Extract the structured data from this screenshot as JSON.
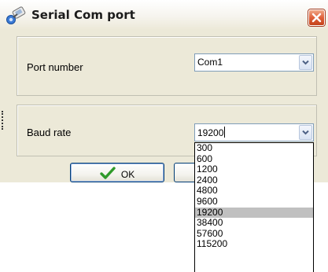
{
  "window": {
    "title": "Serial Com port"
  },
  "port": {
    "label": "Port number",
    "value": "Com1"
  },
  "baud": {
    "label": "Baud rate",
    "value": "19200",
    "options": [
      "300",
      "600",
      "1200",
      "2400",
      "4800",
      "9600",
      "19200",
      "38400",
      "57600",
      "115200"
    ],
    "selected_index": 6
  },
  "buttons": {
    "ok_label": "OK"
  },
  "icons": {
    "app": "serial-port-icon",
    "close": "close-icon",
    "dropdown": "chevron-down-icon",
    "ok": "checkmark-icon"
  },
  "colors": {
    "close_button": "#e0603a",
    "ok_check": "#2f9a2a",
    "selected_option": "#c0c0c0",
    "window_background": "#ece9d8"
  }
}
